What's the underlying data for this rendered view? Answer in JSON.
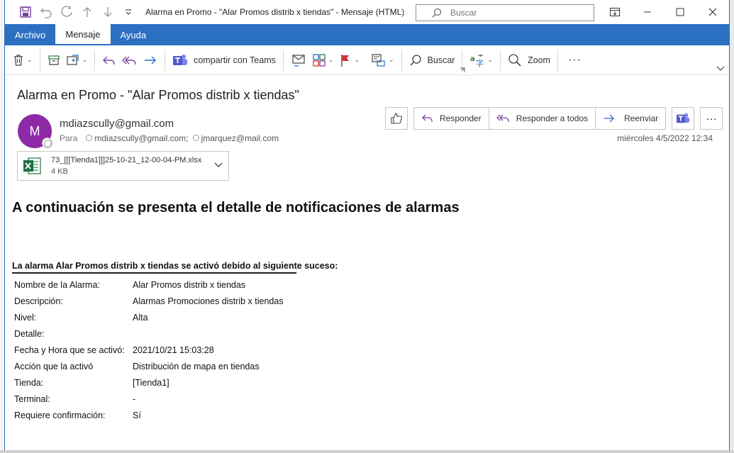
{
  "window": {
    "title": "Alarma en Promo - \"Alar Promos distrib x tiendas\"  -  Mensaje (HTML)",
    "search_placeholder": "Buscar"
  },
  "tabs": [
    {
      "label": "Archivo"
    },
    {
      "label": "Mensaje"
    },
    {
      "label": "Ayuda"
    }
  ],
  "ribbon": {
    "teams_label": "compartir con Teams",
    "search_label": "Buscar",
    "zoom_label": "Zoom",
    "more_label": "···"
  },
  "message": {
    "subject": "Alarma en Promo - \"Alar Promos distrib x tiendas\"",
    "avatar_initial": "M",
    "from": "mdiazscully@gmail.com",
    "to_label": "Para",
    "recipients": [
      "mdiazscully@gmail.com;",
      "jmarquez@mail.com"
    ],
    "date": "miércoles 4/5/2022 12:34",
    "actions": {
      "reply": "Responder",
      "reply_all": "Responder a todos",
      "forward": "Reenviar",
      "more": "···"
    },
    "attachment": {
      "name": "73_[[[Tienda1]]]25-10-21_12-00-04-PM.xlsx",
      "size": "4 KB"
    }
  },
  "body": {
    "title": "A continuación se presenta el detalle de notificaciones de alarmas",
    "trigger_text": "La alarma Alar Promos distrib x tiendas se activó debido al siguiente suceso:",
    "details": [
      {
        "key": "Nombre de la Alarma:",
        "value": "Alar Promos distrib x tiendas"
      },
      {
        "key": "Descripción:",
        "value": "Alarmas Promociones distrib x tiendas"
      },
      {
        "key": "Nivel:",
        "value": "Alta"
      },
      {
        "key": "Detalle:",
        "value": ""
      },
      {
        "key": "Fecha y Hora que se activó:",
        "value": "2021/10/21 15:03:28"
      },
      {
        "key": "Acción que la activó",
        "value": "Distribución de mapa en tiendas"
      },
      {
        "key": "Tienda:",
        "value": "[Tienda1]"
      },
      {
        "key": "Terminal:",
        "value": "-"
      },
      {
        "key": "Requiere confirmación:",
        "value": "Sí"
      }
    ]
  },
  "colors": {
    "accent": "#2b6fc1",
    "avatar": "#8e2aa6",
    "excel_green": "#1d7044",
    "flag_red": "#d13438",
    "teams_purple": "#5059c9"
  }
}
